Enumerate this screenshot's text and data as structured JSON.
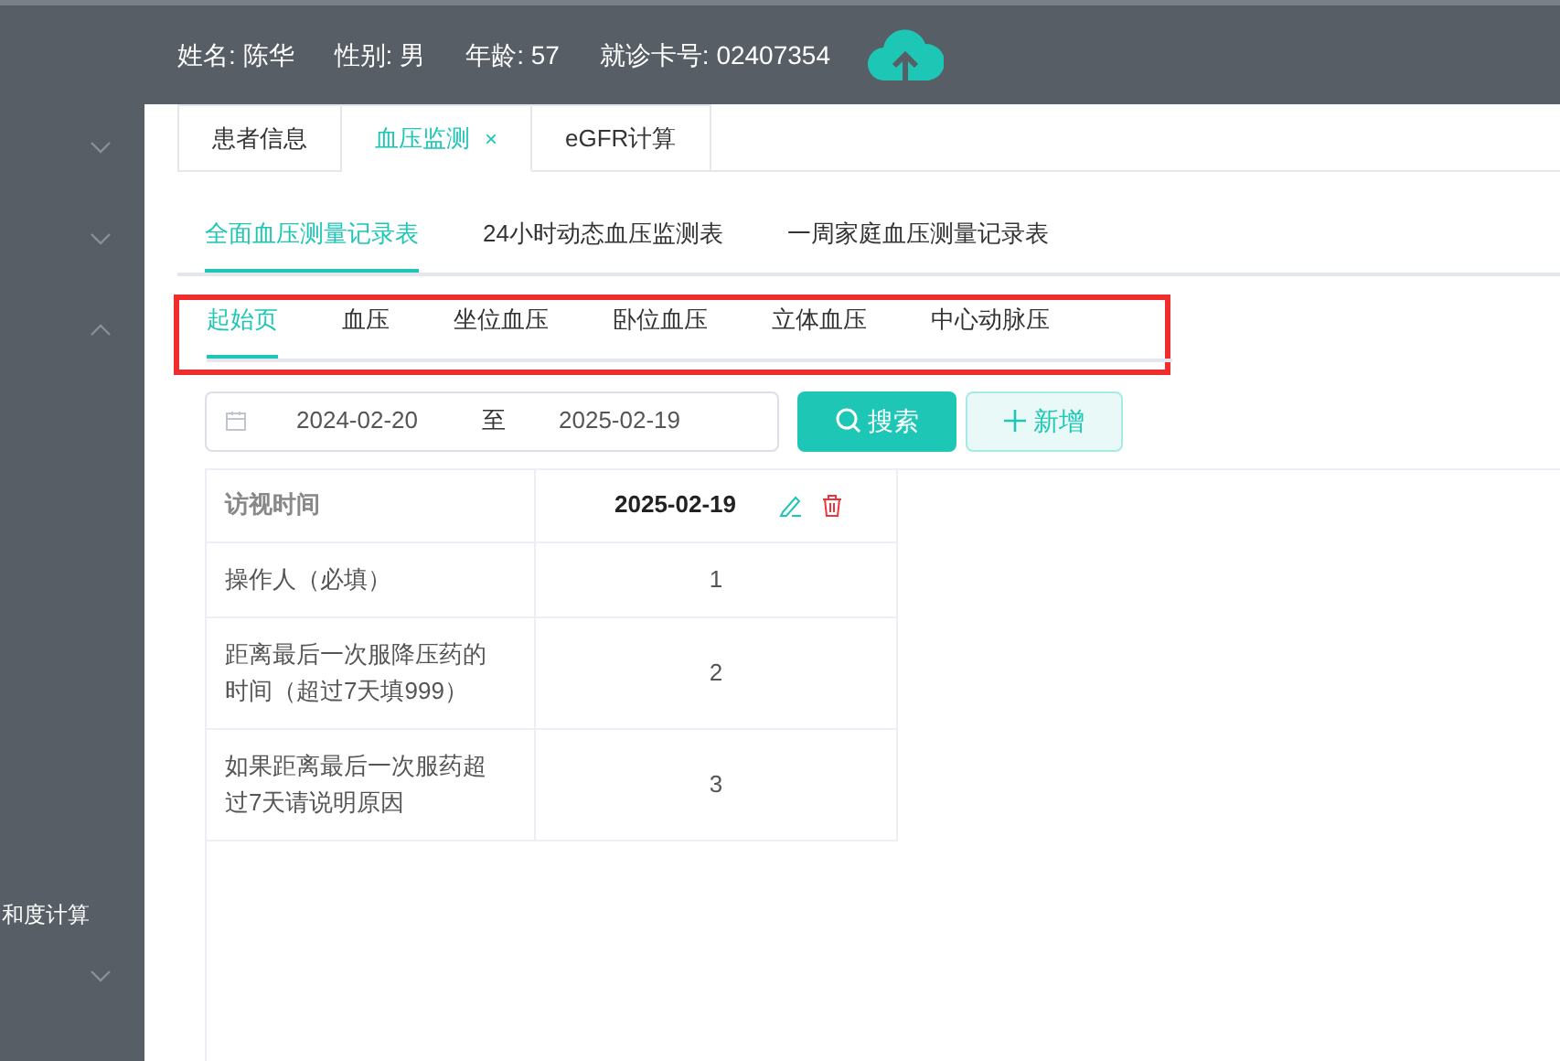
{
  "header": {
    "fields": [
      {
        "label": "姓名:",
        "value": "陈华"
      },
      {
        "label": "性别:",
        "value": "男"
      },
      {
        "label": "年龄:",
        "value": "57"
      },
      {
        "label": "就诊卡号:",
        "value": "02407354"
      }
    ]
  },
  "sidebar": {
    "items": [
      {
        "kind": "group",
        "expanded": false
      },
      {
        "kind": "group",
        "expanded": false
      },
      {
        "kind": "group",
        "expanded": true
      },
      {
        "kind": "link",
        "label": "和度计算"
      },
      {
        "kind": "group",
        "expanded": false
      }
    ]
  },
  "page_tabs": [
    {
      "label": "患者信息",
      "selected": false
    },
    {
      "label": "血压监测",
      "selected": true,
      "close": "×"
    },
    {
      "label": "eGFR计算",
      "selected": false
    }
  ],
  "record_tabs": [
    {
      "label": "全面血压测量记录表",
      "selected": true
    },
    {
      "label": "24小时动态血压监测表",
      "selected": false
    },
    {
      "label": "一周家庭血压测量记录表",
      "selected": false
    }
  ],
  "section_tabs": {
    "highlighted": true,
    "tabs": [
      {
        "label": "起始页",
        "selected": true
      },
      {
        "label": "血压",
        "selected": false
      },
      {
        "label": "坐位血压",
        "selected": false
      },
      {
        "label": "卧位血压",
        "selected": false
      },
      {
        "label": "立体血压",
        "selected": false
      },
      {
        "label": "中心动脉压",
        "selected": false
      }
    ]
  },
  "filter": {
    "start": "2024-02-20",
    "separator": "至",
    "end": "2025-02-19",
    "search_button": "搜索",
    "add_button": "新增"
  },
  "table": {
    "header": {
      "label": "访视时间",
      "date": "2025-02-19"
    },
    "rows": [
      {
        "label": "操作人（必填）",
        "value": "1"
      },
      {
        "label": "距离最后一次服降压药的时间（超过7天填999）",
        "value": "2"
      },
      {
        "label": "如果距离最后一次服药超过7天请说明原因",
        "value": "3"
      }
    ]
  }
}
